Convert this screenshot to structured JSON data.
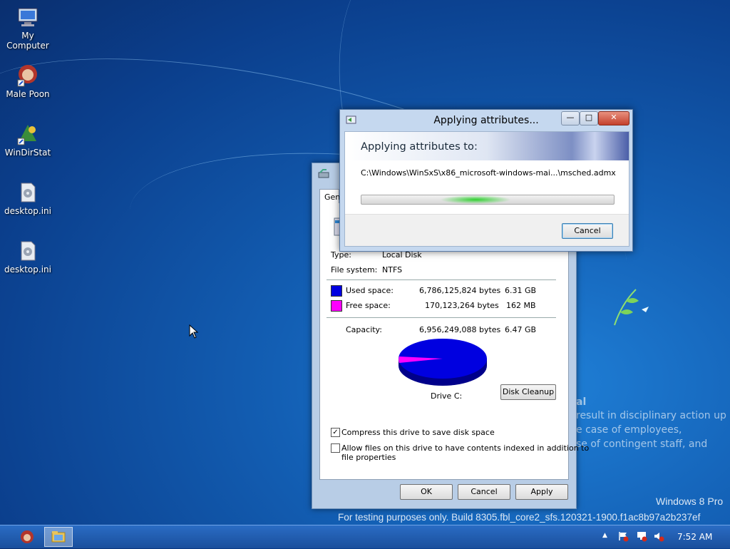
{
  "desktop": {
    "icons": [
      {
        "label": "My Computer",
        "icon": "computer-icon"
      },
      {
        "label": "Male Poon",
        "icon": "user-shortcut-icon"
      },
      {
        "label": "WinDirStat",
        "icon": "windirstat-icon"
      },
      {
        "label": "desktop.ini",
        "icon": "ini-file-icon"
      },
      {
        "label": "desktop.ini",
        "icon": "ini-file-icon"
      }
    ],
    "overlay_lines": [
      "al",
      "result in disciplinary action up",
      "e case of employees,",
      "se of contingent staff, and"
    ],
    "watermark_edition": "Windows 8 Pro",
    "watermark_build": "For testing purposes only. Build 8305.fbl_core2_sfs.120321-1900.f1ac8b97a2b237ef"
  },
  "properties": {
    "tab_label": "Gen",
    "type_label": "Type:",
    "type_value": "Local Disk",
    "fs_label": "File system:",
    "fs_value": "NTFS",
    "used_label": "Used space:",
    "used_bytes": "6,786,125,824 bytes",
    "used_gb": "6.31 GB",
    "free_label": "Free space:",
    "free_bytes": "170,123,264 bytes",
    "free_mb": "162 MB",
    "capacity_label": "Capacity:",
    "capacity_bytes": "6,956,249,088 bytes",
    "capacity_gb": "6.47 GB",
    "drive_label": "Drive C:",
    "cleanup_label": "Disk Cleanup",
    "compress_label": "Compress this drive to save disk space",
    "compress_checked": true,
    "index_label_line1": "Allow files on this drive to have contents indexed in addition to",
    "index_label_line2": "file properties",
    "index_checked": false,
    "ok_label": "OK",
    "cancel_label": "Cancel",
    "apply_label": "Apply",
    "used_color": "#0000e0",
    "free_color": "#ff00ff"
  },
  "apply_dialog": {
    "title": "Applying attributes...",
    "heading": "Applying attributes to:",
    "path": "C:\\Windows\\WinSxS\\x86_microsoft-windows-mai...\\msched.admx",
    "cancel_label": "Cancel"
  },
  "taskbar": {
    "clock": "7:52 AM",
    "tray_arrow": "▲"
  }
}
